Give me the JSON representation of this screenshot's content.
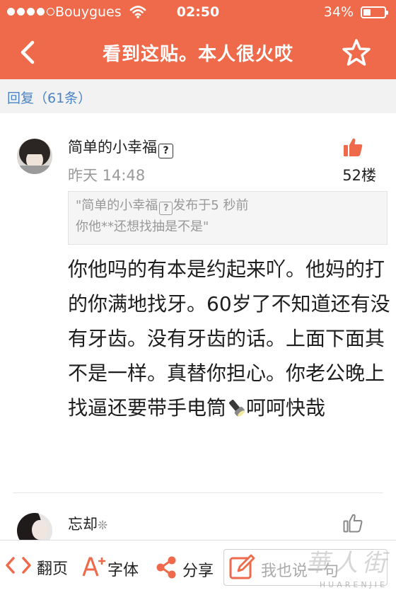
{
  "status_bar": {
    "carrier": "Bouygues",
    "time": "02:50",
    "battery_percent": "34%",
    "battery_level": 0.34,
    "signal_bars_filled": 4,
    "signal_bars_total": 5
  },
  "nav": {
    "title": "看到这贴。本人很火哎",
    "back_icon": "chevron-left-icon",
    "favorite_icon": "star-outline-icon"
  },
  "reply_bar": {
    "count_label": "回复（61条）"
  },
  "post": {
    "username": "简单的小幸福",
    "unknown_glyph": "?",
    "time": "昨天 14:48",
    "floor": "52楼",
    "quote_author": "\"简单的小幸福",
    "quote_after_author": "发布于5 秒前",
    "quote_text": "你他**还想找抽是不是\"",
    "content": "你他吗的有本是约起来吖。他妈的打的你满地找牙。60岁了不知道还有没有牙齿。没有牙齿的话。上面下面其不是一样。真替你担心。你老公晚上找逼还要带手电筒",
    "content_tail": "呵呵快哉",
    "like_icon": "thumbs-up-filled-icon"
  },
  "post2": {
    "username": "忘却",
    "username_suffix": "❊",
    "like_icon": "thumbs-up-outline-icon"
  },
  "bottom_bar": {
    "page_label": "翻页",
    "font_label": "字体",
    "share_label": "分享",
    "reply_placeholder": "我也说一句"
  },
  "watermark": {
    "cn": "華人街",
    "en": "HUARENJIE"
  },
  "colors": {
    "accent": "#EE6A4A",
    "link": "#4C83C4",
    "muted": "#999999"
  }
}
